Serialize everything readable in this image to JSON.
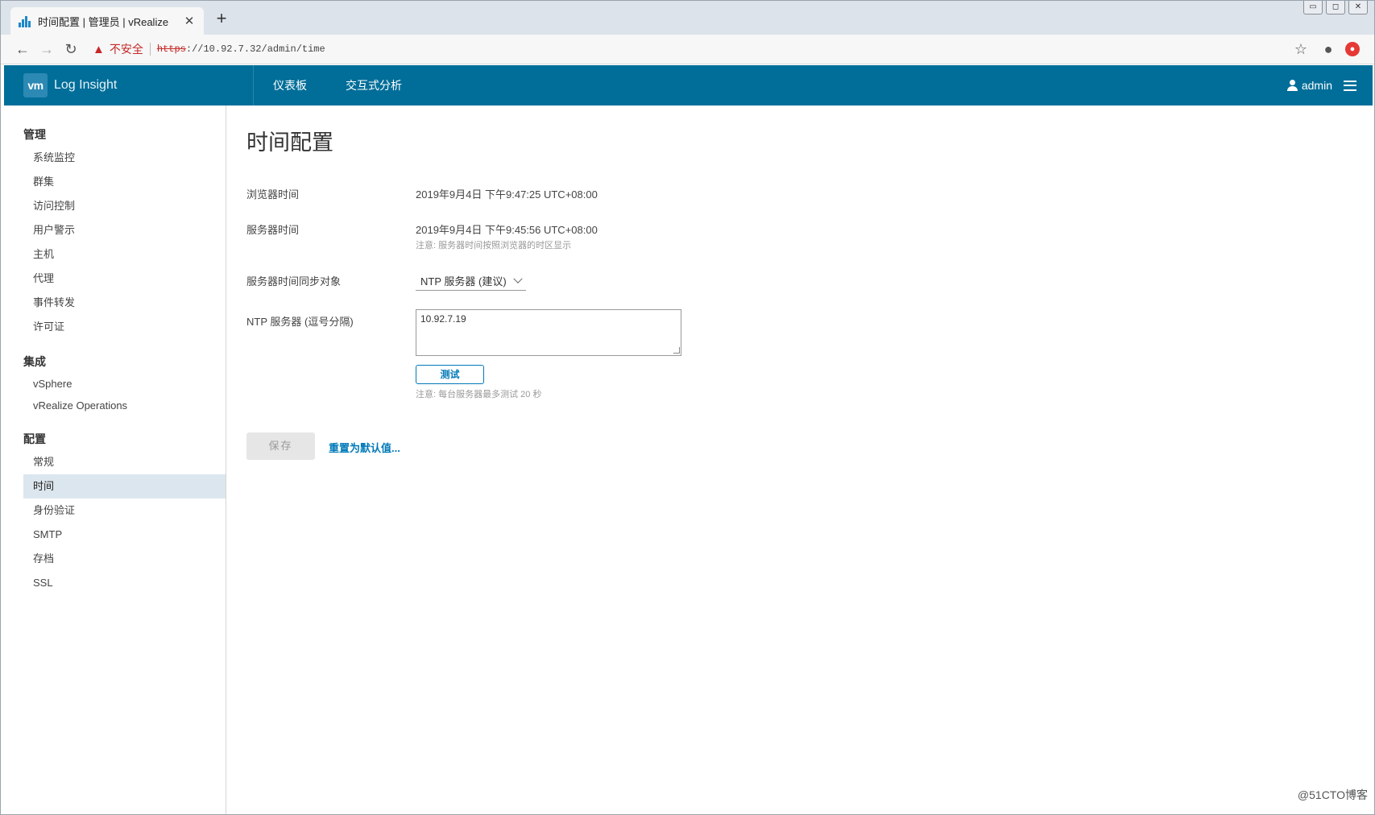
{
  "browser": {
    "tab_title": "时间配置 | 管理员 | vRealize",
    "tab_close": "✕",
    "new_tab": "+",
    "insecure_label": "不安全",
    "url_scheme": "https",
    "url_rest": "://10.92.7.32/admin/time"
  },
  "header": {
    "logo": "vm",
    "brand": "Log Insight",
    "nav": [
      "仪表板",
      "交互式分析"
    ],
    "user": "admin"
  },
  "sidebar": {
    "groups": [
      {
        "heading": "管理",
        "items": [
          "系统监控",
          "群集",
          "访问控制",
          "用户警示",
          "主机",
          "代理",
          "事件转发",
          "许可证"
        ]
      },
      {
        "heading": "集成",
        "items": [
          "vSphere",
          "vRealize Operations"
        ]
      },
      {
        "heading": "配置",
        "items": [
          "常规",
          "时间",
          "身份验证",
          "SMTP",
          "存档",
          "SSL"
        ]
      }
    ],
    "active_item": "时间"
  },
  "main": {
    "title": "时间配置",
    "browser_time_label": "浏览器时间",
    "browser_time_value": "2019年9月4日 下午9:47:25 UTC+08:00",
    "server_time_label": "服务器时间",
    "server_time_value": "2019年9月4日 下午9:45:56 UTC+08:00",
    "server_time_note": "注意: 服务器时间按照浏览器的时区显示",
    "sync_label": "服务器时间同步对象",
    "sync_selected": "NTP 服务器 (建议)",
    "ntp_label": "NTP 服务器 (逗号分隔)",
    "ntp_value": "10.92.7.19",
    "test_button": "测试",
    "test_note": "注意: 每台服务器最多测试 20 秒",
    "save_button": "保存",
    "reset_link": "重置为默认值..."
  },
  "watermark": "@51CTO博客"
}
